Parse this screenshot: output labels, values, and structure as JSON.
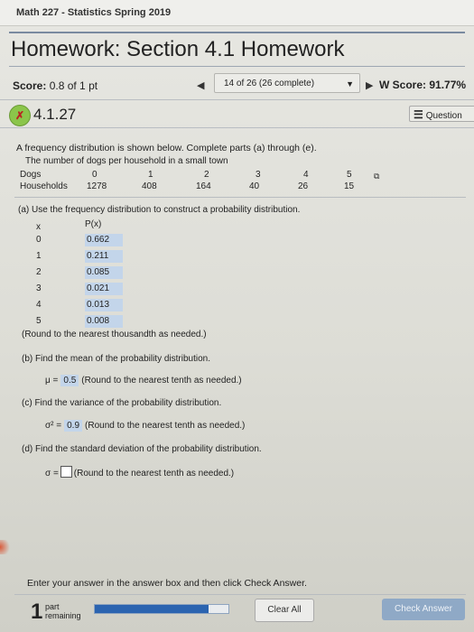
{
  "course": "Math 227 - Statistics Spring 2019",
  "homework_title": "Homework: Section 4.1 Homework",
  "score": {
    "label": "Score:",
    "value": "0.8 of 1 pt"
  },
  "navigation": {
    "prev_icon": "triangle-left-icon",
    "position": "14 of 26 (26 complete)",
    "dropdown_icon": "triangle-down-icon",
    "next_icon": "triangle-right-icon"
  },
  "hw_score": {
    "label": "W Score:",
    "value": "91.77%"
  },
  "question": {
    "number": "4.1.27",
    "status_icon": "partial-credit-icon",
    "list_label": "Question"
  },
  "intro": "A frequency distribution is shown below. Complete parts (a) through (e).",
  "table_caption": "The number of dogs per household in a small town",
  "freq_table": {
    "row1_label": "Dogs",
    "row2_label": "Households",
    "dogs": [
      "0",
      "1",
      "2",
      "3",
      "4",
      "5"
    ],
    "households": [
      "1278",
      "408",
      "164",
      "40",
      "26",
      "15"
    ]
  },
  "part_a": {
    "prompt": "(a) Use the frequency distribution to construct a probability distribution.",
    "x_header": "x",
    "p_header": "P(x)",
    "x_values": [
      "0",
      "1",
      "2",
      "3",
      "4",
      "5"
    ],
    "p_values": [
      "0.662",
      "0.211",
      "0.085",
      "0.021",
      "0.013",
      "0.008"
    ],
    "note": "(Round to the nearest thousandth as needed.)"
  },
  "part_b": {
    "prompt": "(b) Find the mean of the probability distribution.",
    "symbol": "μ =",
    "answer": "0.5",
    "note": "(Round to the nearest tenth as needed.)"
  },
  "part_c": {
    "prompt": "(c) Find the variance of the probability distribution.",
    "symbol": "σ² =",
    "answer": "0.9",
    "note": "(Round to the nearest tenth as needed.)"
  },
  "part_d": {
    "prompt": "(d) Find the standard deviation of the probability distribution.",
    "symbol": "σ =",
    "answer": "",
    "note": "(Round to the nearest tenth as needed.)"
  },
  "instructions": "Enter your answer in the answer box and then click Check Answer.",
  "footer": {
    "parts_remaining_count": "1",
    "parts_line1": "part",
    "parts_line2": "remaining",
    "progress_fraction": 0.85,
    "clear_all": "Clear All",
    "check_answer": "Check Answer"
  }
}
